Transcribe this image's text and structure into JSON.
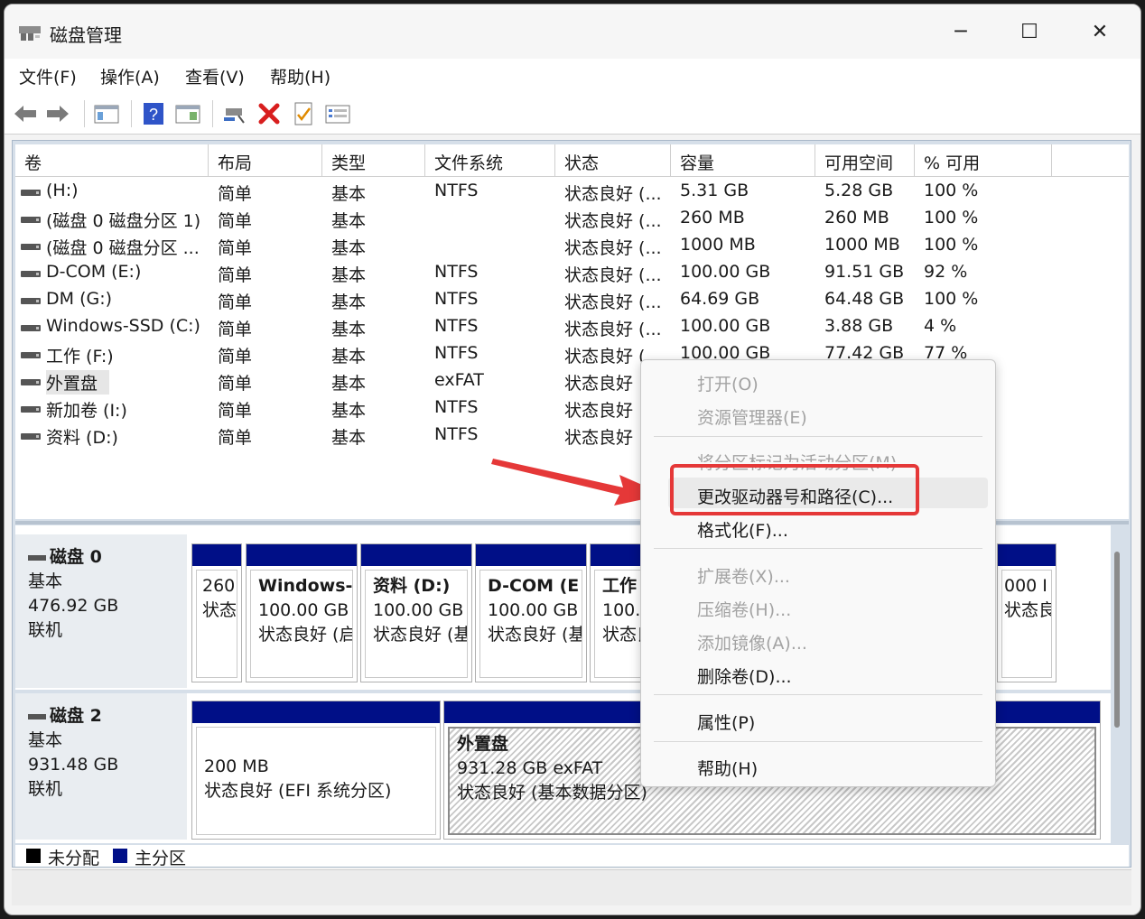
{
  "window": {
    "title": "磁盘管理",
    "minimize": "─",
    "maximize": "☐",
    "close": "✕"
  },
  "menu": [
    "文件(F)",
    "操作(A)",
    "查看(V)",
    "帮助(H)"
  ],
  "columns": [
    "卷",
    "布局",
    "类型",
    "文件系统",
    "状态",
    "容量",
    "可用空间",
    "% 可用"
  ],
  "volumes": [
    {
      "name": "(H:)",
      "layout": "简单",
      "type": "基本",
      "fs": "NTFS",
      "status": "状态良好 (...",
      "capacity": "5.31 GB",
      "free": "5.28 GB",
      "pct": "100 %"
    },
    {
      "name": "(磁盘 0 磁盘分区 1)",
      "layout": "简单",
      "type": "基本",
      "fs": "",
      "status": "状态良好 (...",
      "capacity": "260 MB",
      "free": "260 MB",
      "pct": "100 %"
    },
    {
      "name": "(磁盘 0 磁盘分区 ...",
      "layout": "简单",
      "type": "基本",
      "fs": "",
      "status": "状态良好 (...",
      "capacity": "1000 MB",
      "free": "1000 MB",
      "pct": "100 %"
    },
    {
      "name": "D-COM (E:)",
      "layout": "简单",
      "type": "基本",
      "fs": "NTFS",
      "status": "状态良好 (...",
      "capacity": "100.00 GB",
      "free": "91.51 GB",
      "pct": "92 %"
    },
    {
      "name": "DM (G:)",
      "layout": "简单",
      "type": "基本",
      "fs": "NTFS",
      "status": "状态良好 (...",
      "capacity": "64.69 GB",
      "free": "64.48 GB",
      "pct": "100 %"
    },
    {
      "name": "Windows-SSD (C:)",
      "layout": "简单",
      "type": "基本",
      "fs": "NTFS",
      "status": "状态良好 (...",
      "capacity": "100.00 GB",
      "free": "3.88 GB",
      "pct": "4 %"
    },
    {
      "name": "工作 (F:)",
      "layout": "简单",
      "type": "基本",
      "fs": "NTFS",
      "status": "状态良好 (...",
      "capacity": "100.00 GB",
      "free": "77.42 GB",
      "pct": "77 %"
    },
    {
      "name": "外置盘",
      "layout": "简单",
      "type": "基本",
      "fs": "exFAT",
      "status": "状态良好",
      "capacity": "",
      "free": "",
      "pct": ""
    },
    {
      "name": "新加卷 (I:)",
      "layout": "简单",
      "type": "基本",
      "fs": "NTFS",
      "status": "状态良好",
      "capacity": "",
      "free": "",
      "pct": ""
    },
    {
      "name": "资料 (D:)",
      "layout": "简单",
      "type": "基本",
      "fs": "NTFS",
      "status": "状态良好",
      "capacity": "",
      "free": "",
      "pct": ""
    }
  ],
  "disk0": {
    "name": "磁盘 0",
    "kind": "基本",
    "size": "476.92 GB",
    "state": "联机",
    "parts": [
      {
        "title": "",
        "line1": "260",
        "line2": "状态"
      },
      {
        "title": "Windows-",
        "line1": "100.00 GB",
        "line2": "状态良好 (启"
      },
      {
        "title": "资料  (D:)",
        "line1": "100.00 GB",
        "line2": "状态良好 (基"
      },
      {
        "title": "D-COM  (E",
        "line1": "100.00 GB",
        "line2": "状态良好 (基"
      },
      {
        "title": "工作",
        "line1": "100.0",
        "line2": "状态良"
      },
      {
        "title": "",
        "line1": "000 I",
        "line2": "状态良"
      }
    ]
  },
  "disk2": {
    "name": "磁盘 2",
    "kind": "基本",
    "size": "931.48 GB",
    "state": "联机",
    "parts": [
      {
        "title": "",
        "line1": "200 MB",
        "line2": "状态良好 (EFI 系统分区)"
      },
      {
        "title": "外置盘",
        "line1": "931.28 GB exFAT",
        "line2": "状态良好 (基本数据分区)"
      }
    ]
  },
  "legend": {
    "unallocated": "未分配",
    "primary": "主分区",
    "unallocated_color": "#000000",
    "primary_color": "#000f87"
  },
  "context_menu": {
    "open": "打开(O)",
    "explorer": "资源管理器(E)",
    "mark_active": "将分区标记为活动分区(M)",
    "change_letter": "更改驱动器号和路径(C)...",
    "format": "格式化(F)...",
    "extend": "扩展卷(X)...",
    "shrink": "压缩卷(H)...",
    "mirror": "添加镜像(A)...",
    "delete": "删除卷(D)...",
    "properties": "属性(P)",
    "help": "帮助(H)"
  },
  "colors": {
    "accent_red": "#e53838",
    "partition_header": "#000f87"
  }
}
